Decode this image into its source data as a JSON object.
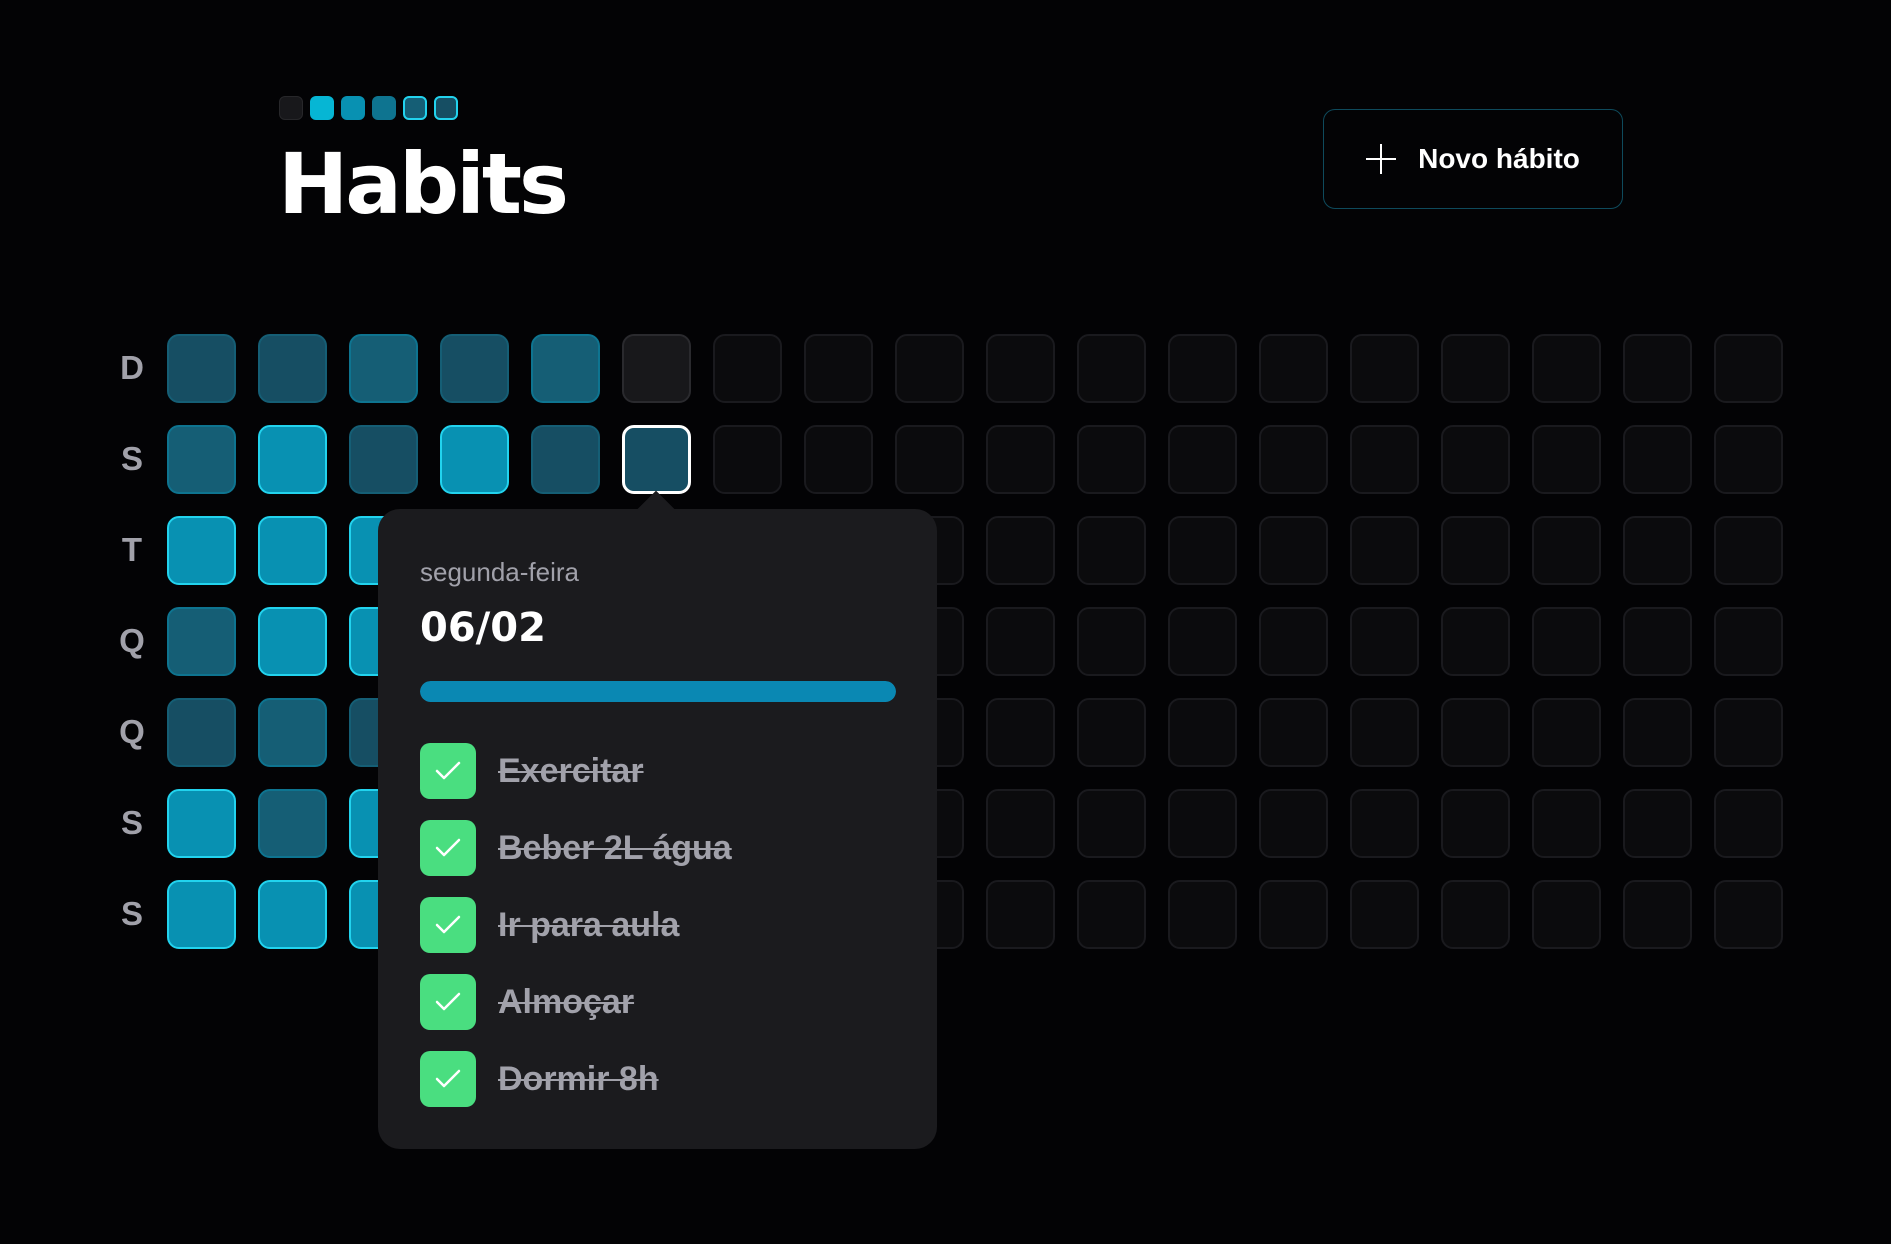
{
  "header": {
    "title": "Habits",
    "logo_colors": [
      "#18181b",
      "#06b6d4",
      "#0891b2",
      "#0e7490",
      "#155e75",
      "#164e63"
    ],
    "new_habit_label": "Novo hábito",
    "new_habit_icon": "plus-icon"
  },
  "weekdays": [
    "D",
    "S",
    "T",
    "Q",
    "Q",
    "S",
    "S"
  ],
  "summary": {
    "note": "levels 0-4 per day; null = future day",
    "colors": {
      "future": "#0b0b0d",
      "0": "#18181b",
      "1": "#164e63",
      "2": "#155e75",
      "3": "#0e7490",
      "4": "#0891b2"
    },
    "columns": [
      [
        1,
        2,
        4,
        2,
        1,
        4,
        4
      ],
      [
        1,
        4,
        4,
        4,
        2,
        2,
        4
      ],
      [
        2,
        1,
        4,
        4,
        1,
        4,
        4
      ],
      [
        1,
        4,
        4,
        4,
        3,
        2,
        4
      ],
      [
        2,
        1,
        4,
        2,
        1,
        1,
        2
      ],
      [
        0,
        1,
        null,
        null,
        null,
        null,
        null
      ]
    ],
    "total_columns": 18,
    "selected": {
      "column": 5,
      "row": 1
    }
  },
  "popover": {
    "weekday": "segunda-feira",
    "date": "06/02",
    "progress": 1.0,
    "progress_color": "#0a88b3",
    "check_color": "#4ade80",
    "check_icon": "check-icon",
    "habits": [
      {
        "label": "Exercitar",
        "completed": true
      },
      {
        "label": "Beber 2L água",
        "completed": true
      },
      {
        "label": "Ir para aula",
        "completed": true
      },
      {
        "label": "Almoçar",
        "completed": true
      },
      {
        "label": "Dormir 8h",
        "completed": true
      }
    ]
  }
}
